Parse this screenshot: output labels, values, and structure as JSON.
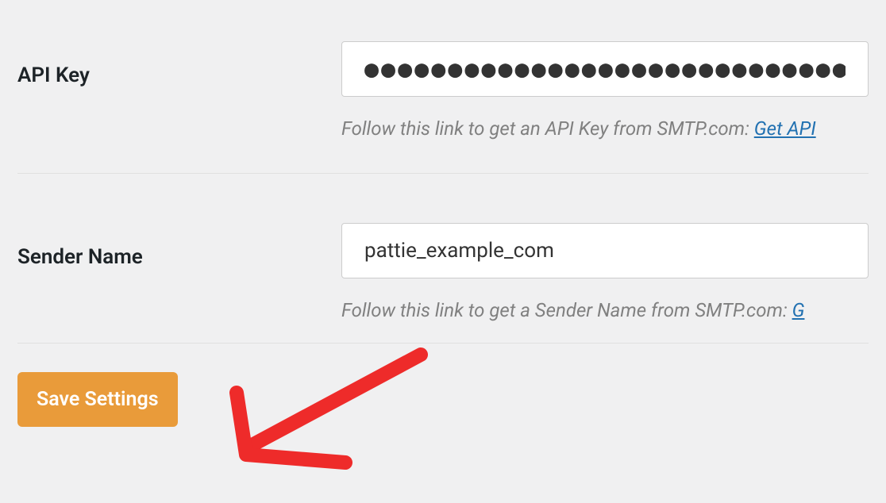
{
  "fields": {
    "api_key": {
      "label": "API Key",
      "value": "●●●●●●●●●●●●●●●●●●●●●●●●●●●●●●●●●●●●●●●●",
      "help_prefix": "Follow this link to get an API Key from SMTP.com: ",
      "help_link_text": "Get API"
    },
    "sender_name": {
      "label": "Sender Name",
      "value": "pattie_example_com",
      "help_prefix": "Follow this link to get a Sender Name from SMTP.com: ",
      "help_link_text": "G"
    }
  },
  "buttons": {
    "save": "Save Settings"
  },
  "colors": {
    "accent": "#e99b3a",
    "link": "#2271b1",
    "annotation": "#ee2b2a"
  }
}
